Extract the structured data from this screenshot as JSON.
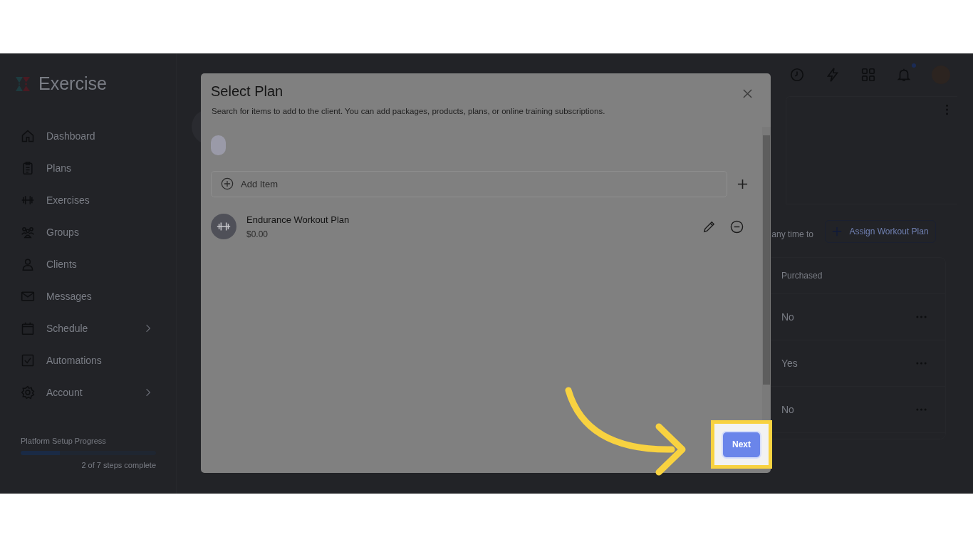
{
  "brand": "Exercise",
  "sidebar": {
    "items": [
      {
        "label": "Dashboard",
        "has_submenu": false
      },
      {
        "label": "Plans",
        "has_submenu": false
      },
      {
        "label": "Exercises",
        "has_submenu": false
      },
      {
        "label": "Groups",
        "has_submenu": false
      },
      {
        "label": "Clients",
        "has_submenu": false
      },
      {
        "label": "Messages",
        "has_submenu": false
      },
      {
        "label": "Schedule",
        "has_submenu": true
      },
      {
        "label": "Automations",
        "has_submenu": false
      },
      {
        "label": "Account",
        "has_submenu": true
      }
    ]
  },
  "setup_progress": {
    "title": "Platform Setup Progress",
    "level": 0.29,
    "caption": "2 of 7 steps complete"
  },
  "topbar": {
    "has_unread_notifications": true
  },
  "background": {
    "text_fragment": "any time to",
    "assign_button": "Assign Workout Plan",
    "table": {
      "columns": [
        "Purchased"
      ],
      "rows": [
        [
          "No"
        ],
        [
          "Yes"
        ],
        [
          "No"
        ]
      ]
    }
  },
  "modal": {
    "title": "Select Plan",
    "description": "Search for items to add to the client. You can add packages, products, plans, or online training subscriptions.",
    "add_item_placeholder": "Add Item",
    "items": [
      {
        "name": "Endurance Workout Plan",
        "price": "$0.00"
      }
    ],
    "next_button": "Next"
  }
}
